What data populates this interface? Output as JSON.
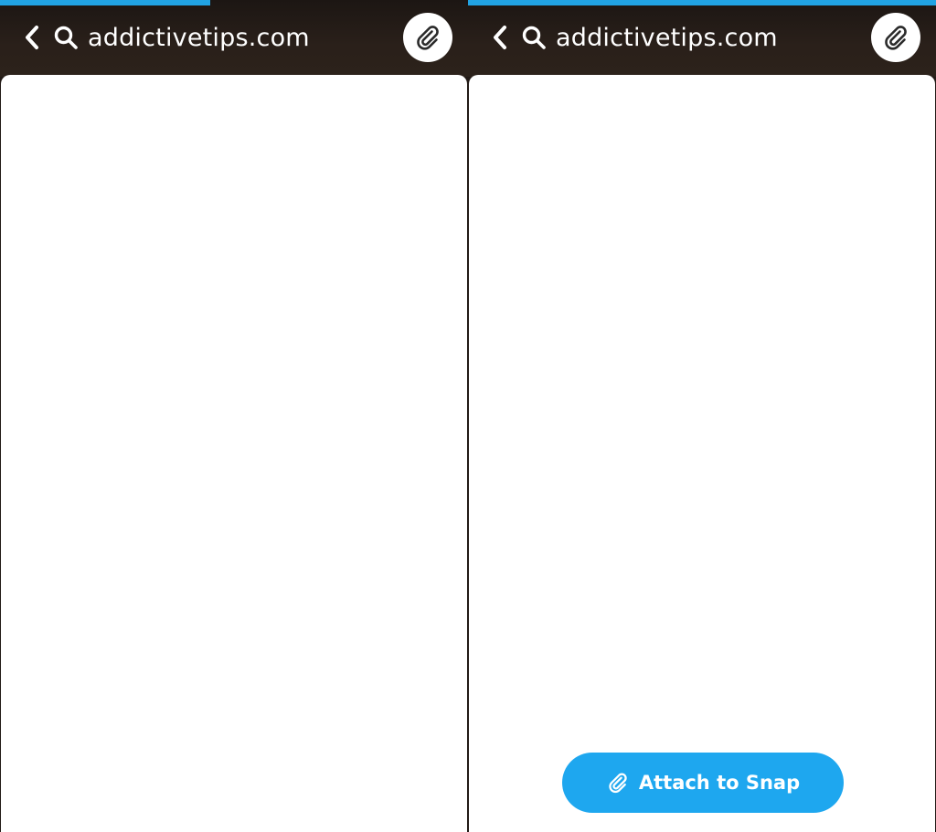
{
  "theme": {
    "progress_color": "#21a3e3",
    "button_color": "#1ea7ef",
    "topbar_color": "#221a16"
  },
  "left_panel": {
    "progress": 0.45,
    "back_icon": "chevron-left-icon",
    "search_icon": "search-icon",
    "url": "addictivetips.com",
    "attach_icon": "paperclip-icon"
  },
  "right_panel": {
    "progress": 1.0,
    "back_icon": "chevron-left-icon",
    "search_icon": "search-icon",
    "url": "addictivetips.com",
    "attach_icon": "paperclip-icon",
    "attach_button": {
      "icon": "paperclip-icon",
      "label": "Attach to Snap"
    }
  }
}
